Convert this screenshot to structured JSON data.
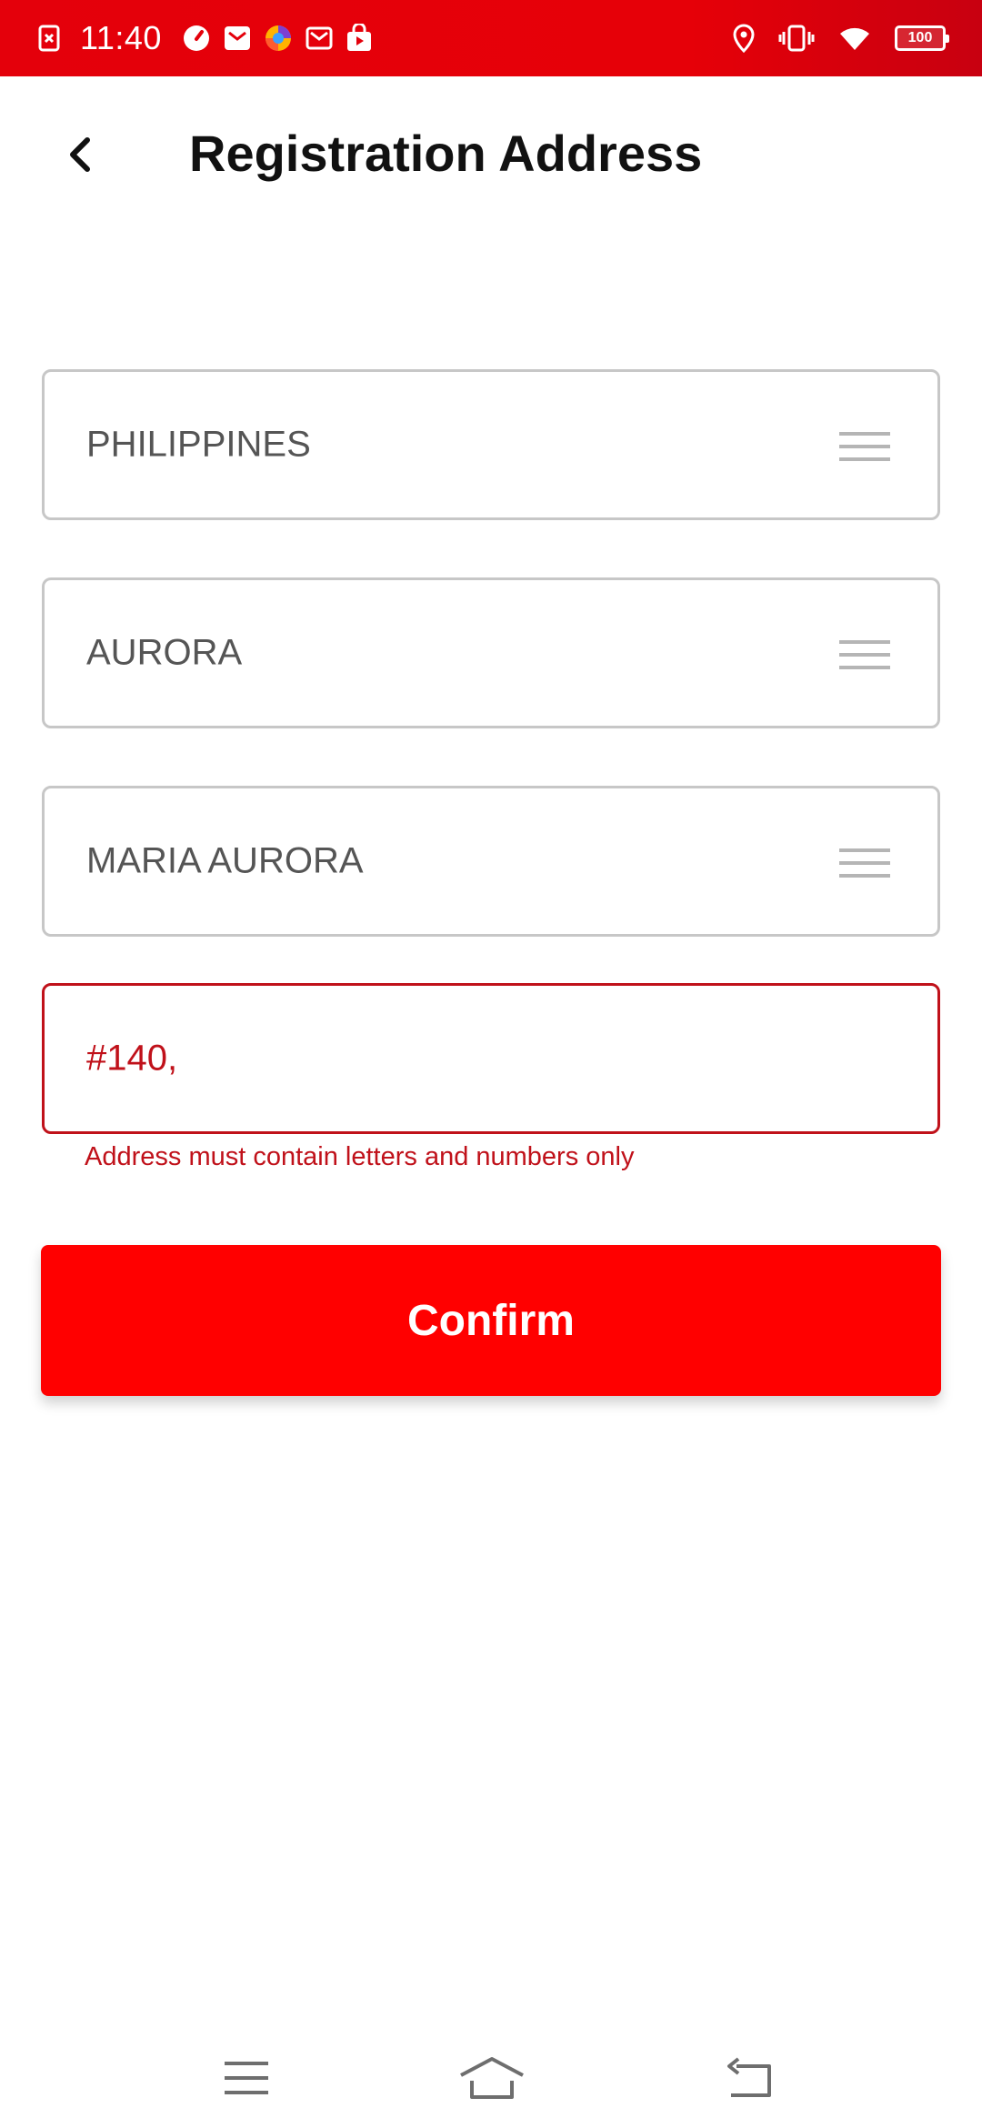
{
  "status_bar": {
    "time": "11:40",
    "battery": "100",
    "icons_left": [
      "notification-blocked-icon",
      "speedometer-icon",
      "mail-icon",
      "browser-icon",
      "gmail-icon",
      "store-bag-icon"
    ],
    "icons_right": [
      "location-icon",
      "vibrate-icon",
      "wifi-icon",
      "battery-icon"
    ],
    "background_color": "#e60008"
  },
  "header": {
    "title": "Registration Address",
    "back_icon": "chevron-left-icon"
  },
  "form": {
    "country": "PHILIPPINES",
    "province": "AURORA",
    "city": "MARIA AURORA",
    "address": "#140,",
    "address_error": "Address must contain letters and numbers only",
    "confirm_label": "Confirm"
  },
  "colors": {
    "accent": "#ff0000",
    "error": "#c0111a",
    "field_border": "#c7c7c7"
  },
  "nav_bar": {
    "icons": [
      "menu-icon",
      "home-icon",
      "back-icon"
    ]
  }
}
